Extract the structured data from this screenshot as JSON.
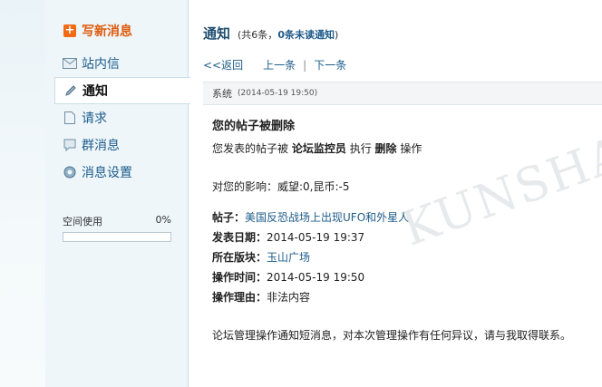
{
  "sidebar": {
    "compose_label": "写新消息",
    "items": [
      {
        "label": "站内信",
        "icon": "envelope-icon"
      },
      {
        "label": "通知",
        "icon": "pencil-icon"
      },
      {
        "label": "请求",
        "icon": "document-icon"
      },
      {
        "label": "群消息",
        "icon": "chat-bubble-icon"
      },
      {
        "label": "消息设置",
        "icon": "settings-circle-icon"
      }
    ],
    "space": {
      "label": "空间使用",
      "percent_text": "0%",
      "fraction": 0
    }
  },
  "main": {
    "title": "通知",
    "count_prefix": "(共6条，",
    "unread_count": "0条未读通知",
    "count_suffix": ")",
    "pager": {
      "back": "<<返回",
      "prev": "上一条",
      "separator": "|",
      "next": "下一条"
    },
    "message": {
      "sender": "系统",
      "time": "(2014-05-19 19:50)",
      "title": "您的帖子被删除",
      "action_prefix": "您发表的帖子被",
      "actor": "论坛监控员",
      "action_mid": "执行",
      "action_word": "删除",
      "action_suffix": "操作",
      "impact": "对您的影响：威望:0,昆币:-5",
      "fields": [
        {
          "label": "帖子：",
          "value": "美国反恐战场上出现UFO和外星人",
          "is_link": true
        },
        {
          "label": "发表日期：",
          "value": "2014-05-19 19:37",
          "is_link": false
        },
        {
          "label": "所在版块：",
          "value": "玉山广场",
          "is_link": true
        },
        {
          "label": "操作时间：",
          "value": "2014-05-19 19:50",
          "is_link": false
        },
        {
          "label": "操作理由：",
          "value": "非法内容",
          "is_link": false
        }
      ],
      "footer": "论坛管理操作通知短消息，对本次管理操作有任何异议，请与我取得联系。"
    },
    "watermark": "KUNSHAN BBS"
  },
  "colors": {
    "accent_orange": "#f06b14",
    "link_blue": "#1d5c8a",
    "sidebar_bg": "#eef6fa"
  }
}
